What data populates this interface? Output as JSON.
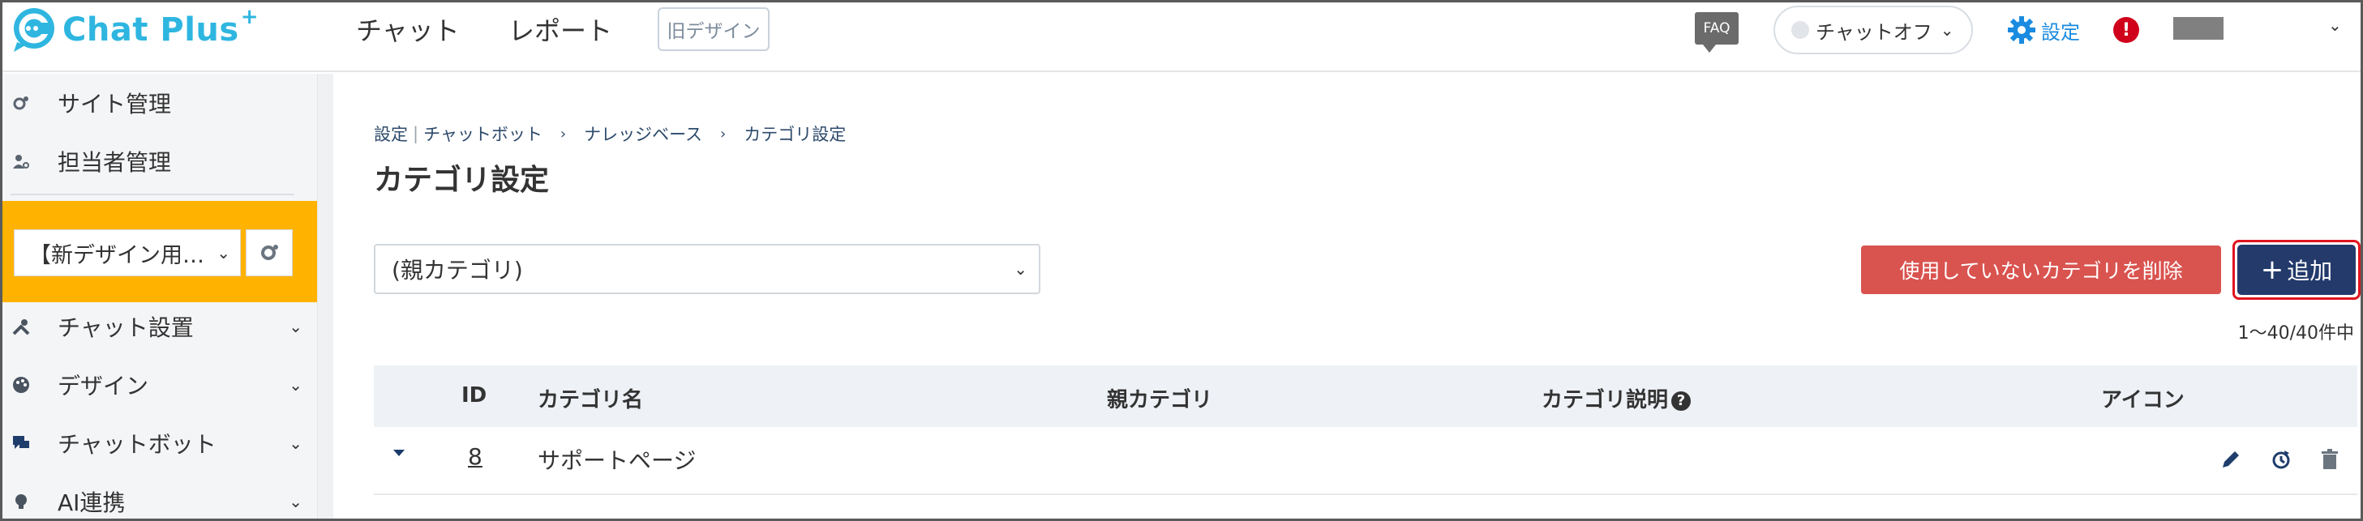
{
  "header": {
    "logo_text": "Chat Plus",
    "logo_plus": "+",
    "nav": [
      "チャット",
      "レポート"
    ],
    "old_design_label": "旧デザイン",
    "faq_label": "FAQ",
    "chat_status": "チャットオフ",
    "settings_label": "設定",
    "alert_mark": "!"
  },
  "sidebar": {
    "top_items": [
      {
        "label": "サイト管理",
        "icon": "gear-person-icon"
      },
      {
        "label": "担当者管理",
        "icon": "person-gear-icon"
      }
    ],
    "site_select_value": "【新デザイン用…",
    "sections": [
      {
        "label": "チャット設置",
        "icon": "tools-icon"
      },
      {
        "label": "デザイン",
        "icon": "palette-icon"
      },
      {
        "label": "チャットボット",
        "icon": "chat-bubbles-icon"
      },
      {
        "label": "AI連携",
        "icon": "lightbulb-icon"
      }
    ]
  },
  "breadcrumb": {
    "items": [
      "設定",
      "チャットボット",
      "ナレッジベース",
      "カテゴリ設定"
    ]
  },
  "page": {
    "title": "カテゴリ設定",
    "parent_select_value": "(親カテゴリ)",
    "delete_unused_label": "使用していないカテゴリを削除",
    "add_label": "追加",
    "add_plus": "+",
    "count_text": "1～40/40件中"
  },
  "table": {
    "headers": {
      "id": "ID",
      "name": "カテゴリ名",
      "parent": "親カテゴリ",
      "description": "カテゴリ説明",
      "icon": "アイコン"
    },
    "help_mark": "?",
    "rows": [
      {
        "id": "8",
        "name": "サポートページ",
        "parent": "",
        "description": ""
      }
    ]
  },
  "colors": {
    "brand": "#2fb6e0",
    "sidebar_highlight": "#ffb300",
    "danger": "#d9534f",
    "primary": "#233a6b",
    "settings": "#1a8be0",
    "alert": "#d0021b"
  }
}
